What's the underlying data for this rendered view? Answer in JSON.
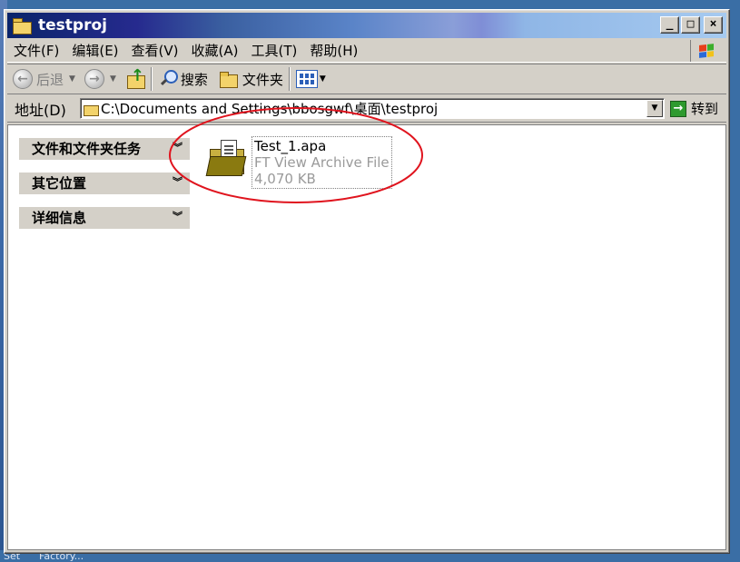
{
  "window": {
    "title": "testproj"
  },
  "title_buttons": {
    "minimize": "_",
    "maximize": "□",
    "close": "×"
  },
  "menu": {
    "items": [
      "文件(F)",
      "编辑(E)",
      "查看(V)",
      "收藏(A)",
      "工具(T)",
      "帮助(H)"
    ]
  },
  "toolbar": {
    "back_label": "后退",
    "search_label": "搜索",
    "folders_label": "文件夹"
  },
  "address": {
    "label": "地址(D)",
    "path": "C:\\Documents and Settings\\bbosgwf\\桌面\\testproj",
    "go_label": "转到"
  },
  "task_panel": {
    "sections": [
      "文件和文件夹任务",
      "其它位置",
      "详细信息"
    ]
  },
  "file": {
    "name": "Test_1.apa",
    "type": "FT View Archive File",
    "size": "4,070 KB"
  },
  "desktop": {
    "bottom_text": "Set      Factory..."
  },
  "colors": {
    "highlight_ellipse": "#e0141e",
    "window_face": "#d4d0c8",
    "titlebar_start": "#0a246a",
    "desktop": "#3a6ea5"
  },
  "icons": [
    "folder-icon",
    "back-icon",
    "forward-icon",
    "up-folder-icon",
    "search-icon",
    "folders-icon",
    "views-icon",
    "go-icon",
    "windows-logo-icon",
    "chevron-double-down-icon",
    "archive-file-icon"
  ]
}
